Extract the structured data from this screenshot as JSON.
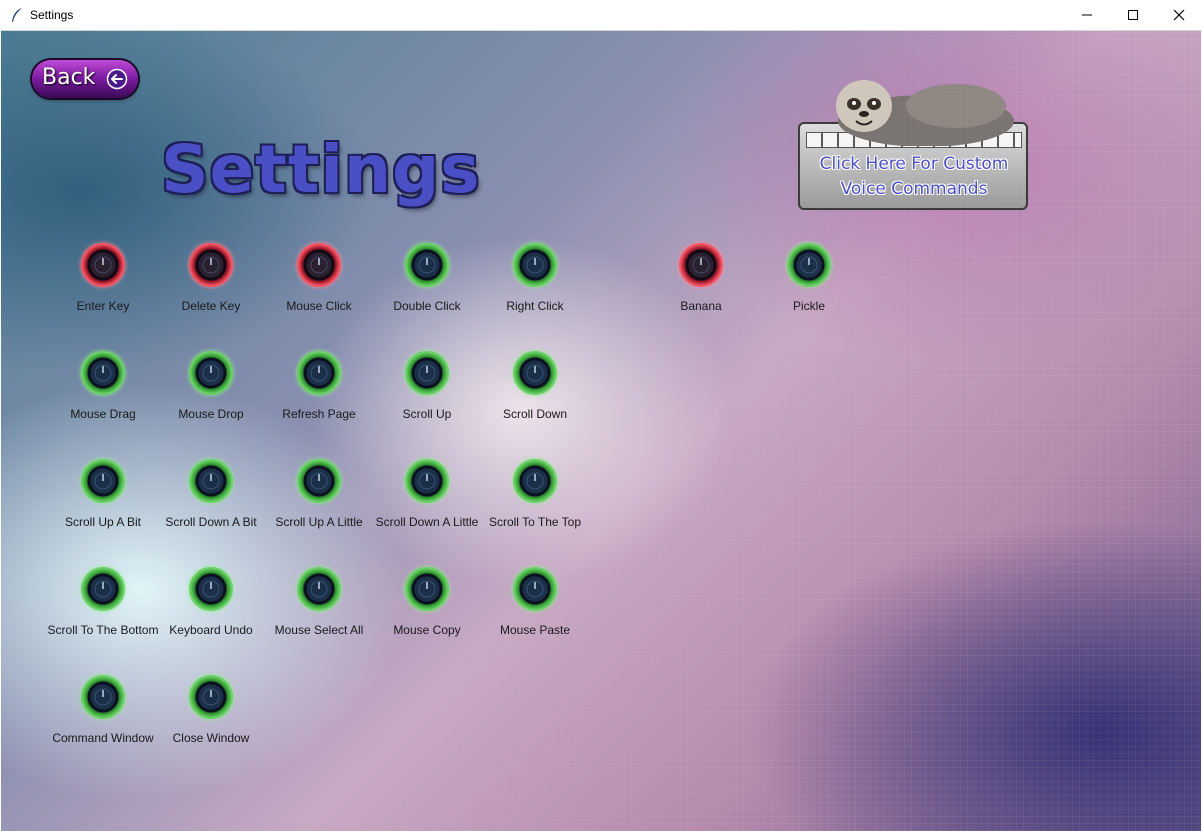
{
  "window": {
    "title": "Settings",
    "controls": {
      "minimize": "minimize-icon",
      "maximize": "maximize-icon",
      "close": "close-icon"
    }
  },
  "header": {
    "back_label": "Back",
    "heading": "Settings",
    "custom_commands_label": "Click Here For Custom Voice Commands"
  },
  "colors": {
    "enabled": "#3fbf3a",
    "disabled": "#e0243a",
    "heading": "#4b4fc6",
    "back_button": "#7a1aa0"
  },
  "commands": [
    {
      "label": "Enter Key",
      "enabled": false
    },
    {
      "label": "Delete Key",
      "enabled": false
    },
    {
      "label": "Mouse Click",
      "enabled": false
    },
    {
      "label": "Double Click",
      "enabled": true
    },
    {
      "label": "Right Click",
      "enabled": true
    },
    {
      "label": "Mouse Drag",
      "enabled": true
    },
    {
      "label": "Mouse Drop",
      "enabled": true
    },
    {
      "label": "Refresh Page",
      "enabled": true
    },
    {
      "label": "Scroll Up",
      "enabled": true
    },
    {
      "label": "Scroll Down",
      "enabled": true
    },
    {
      "label": "Scroll Up A Bit",
      "enabled": true
    },
    {
      "label": "Scroll Down A Bit",
      "enabled": true
    },
    {
      "label": "Scroll Up A Little",
      "enabled": true
    },
    {
      "label": "Scroll Down A Little",
      "enabled": true
    },
    {
      "label": "Scroll To The Top",
      "enabled": true
    },
    {
      "label": "Scroll To The Bottom",
      "enabled": true
    },
    {
      "label": "Keyboard Undo",
      "enabled": true
    },
    {
      "label": "Mouse Select All",
      "enabled": true
    },
    {
      "label": "Mouse Copy",
      "enabled": true
    },
    {
      "label": "Mouse Paste",
      "enabled": true
    },
    {
      "label": "Command Window",
      "enabled": true
    },
    {
      "label": "Close Window",
      "enabled": true
    }
  ],
  "custom_commands": [
    {
      "label": "Banana",
      "enabled": false
    },
    {
      "label": "Pickle",
      "enabled": true
    }
  ]
}
